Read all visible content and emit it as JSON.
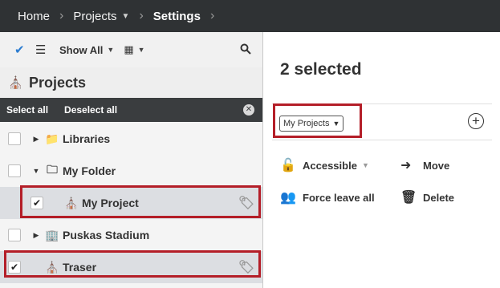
{
  "breadcrumb": {
    "home": "Home",
    "projects": "Projects",
    "settings": "Settings"
  },
  "toolbar": {
    "show_all": "Show All"
  },
  "projects_panel": {
    "title": "Projects",
    "select_all": "Select all",
    "deselect_all": "Deselect all",
    "items": [
      {
        "label": "Libraries",
        "checked": false,
        "icon": "folder-library-icon"
      },
      {
        "label": "My Folder",
        "checked": false,
        "icon": "folder-icon"
      },
      {
        "label": "My Project",
        "checked": true,
        "icon": "project-icon"
      },
      {
        "label": "Puskas Stadium",
        "checked": false,
        "icon": "building-icon"
      },
      {
        "label": "Traser",
        "checked": true,
        "icon": "project-icon"
      }
    ]
  },
  "details": {
    "selected_count": "2 selected",
    "filter_value": "My Projects",
    "actions": {
      "accessible": "Accessible",
      "move": "Move",
      "force_leave_all": "Force leave all",
      "delete": "Delete"
    }
  },
  "colors": {
    "topbar": "#2f3234",
    "highlight": "#b41e28",
    "checkmark_accent": "#2a7bd0"
  }
}
